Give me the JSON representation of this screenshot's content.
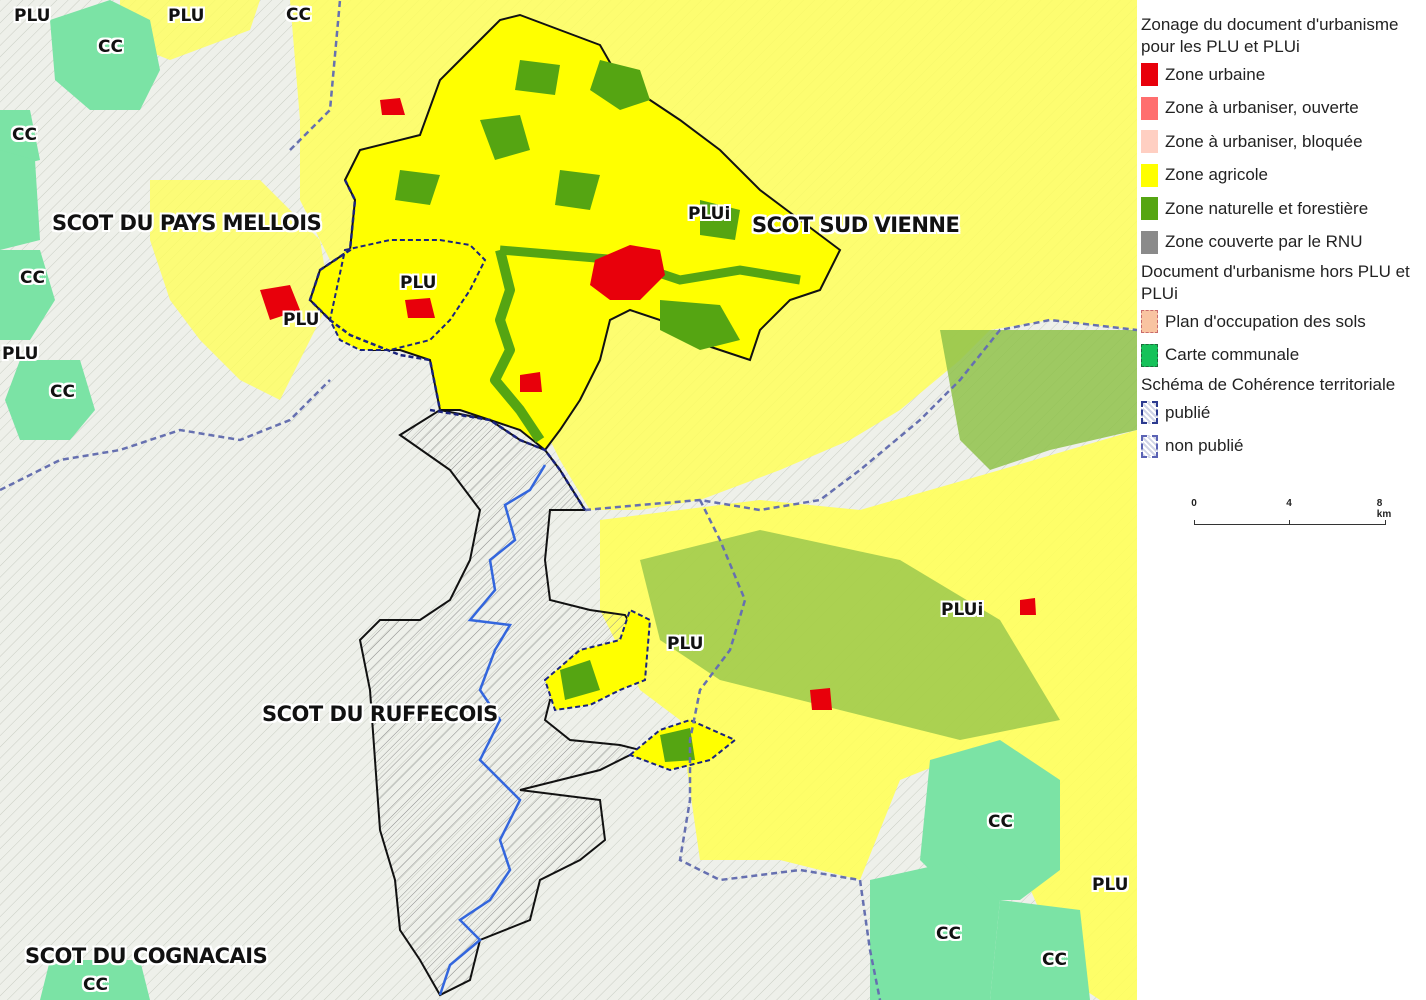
{
  "colors": {
    "zone_urbaine": "#e8000b",
    "zone_urbaniser_ouverte": "#ff6e6e",
    "zone_urbaniser_bloquee": "#ffcfc2",
    "zone_agricole": "#ffff00",
    "zone_naturelle": "#55a512",
    "zone_rnu": "#8a8a8a",
    "pos": "#f9c4a1",
    "carte_communale": "#16c25a",
    "scot_border": "#2c3a8f"
  },
  "legend": {
    "title1": "Zonage du document d'urbanisme pour les PLU et PLUi",
    "items1": [
      {
        "label": "Zone urbaine",
        "swatch": "zone_urbaine"
      },
      {
        "label": "Zone à urbaniser, ouverte",
        "swatch": "zone_urbaniser_ouverte"
      },
      {
        "label": "Zone à urbaniser, bloquée",
        "swatch": "zone_urbaniser_bloquee"
      },
      {
        "label": "Zone agricole",
        "swatch": "zone_agricole"
      },
      {
        "label": "Zone naturelle et forestière",
        "swatch": "zone_naturelle"
      },
      {
        "label": "Zone couverte par le RNU",
        "swatch": "zone_rnu"
      }
    ],
    "title2": "Document d'urbanisme hors PLU et PLUi",
    "items2": [
      {
        "label": "Plan d'occupation des sols",
        "swatch": "pos"
      },
      {
        "label": "Carte communale",
        "swatch": "carte_communale"
      }
    ],
    "title3": "Schéma de Cohérence territoriale",
    "items3": [
      {
        "label": "publié",
        "swatch": "scot_publie"
      },
      {
        "label": "non publié",
        "swatch": "scot_non_publie"
      }
    ]
  },
  "scale": {
    "ticks": [
      "0",
      "4",
      "8 km"
    ]
  },
  "map_labels": {
    "scot": [
      "SCOT DU PAYS MELLOIS",
      "SCOT SUD VIENNE",
      "SCOT DU RUFFECOIS",
      "SCOT DU COGNACAIS"
    ],
    "docs": [
      "PLU",
      "PLU",
      "CC",
      "CC",
      "CC",
      "PLU",
      "CC",
      "CC",
      "PLU",
      "PLUi",
      "PLU",
      "PLU",
      "PLUi",
      "CC",
      "CC",
      "CC",
      "PLU",
      "CC"
    ]
  }
}
